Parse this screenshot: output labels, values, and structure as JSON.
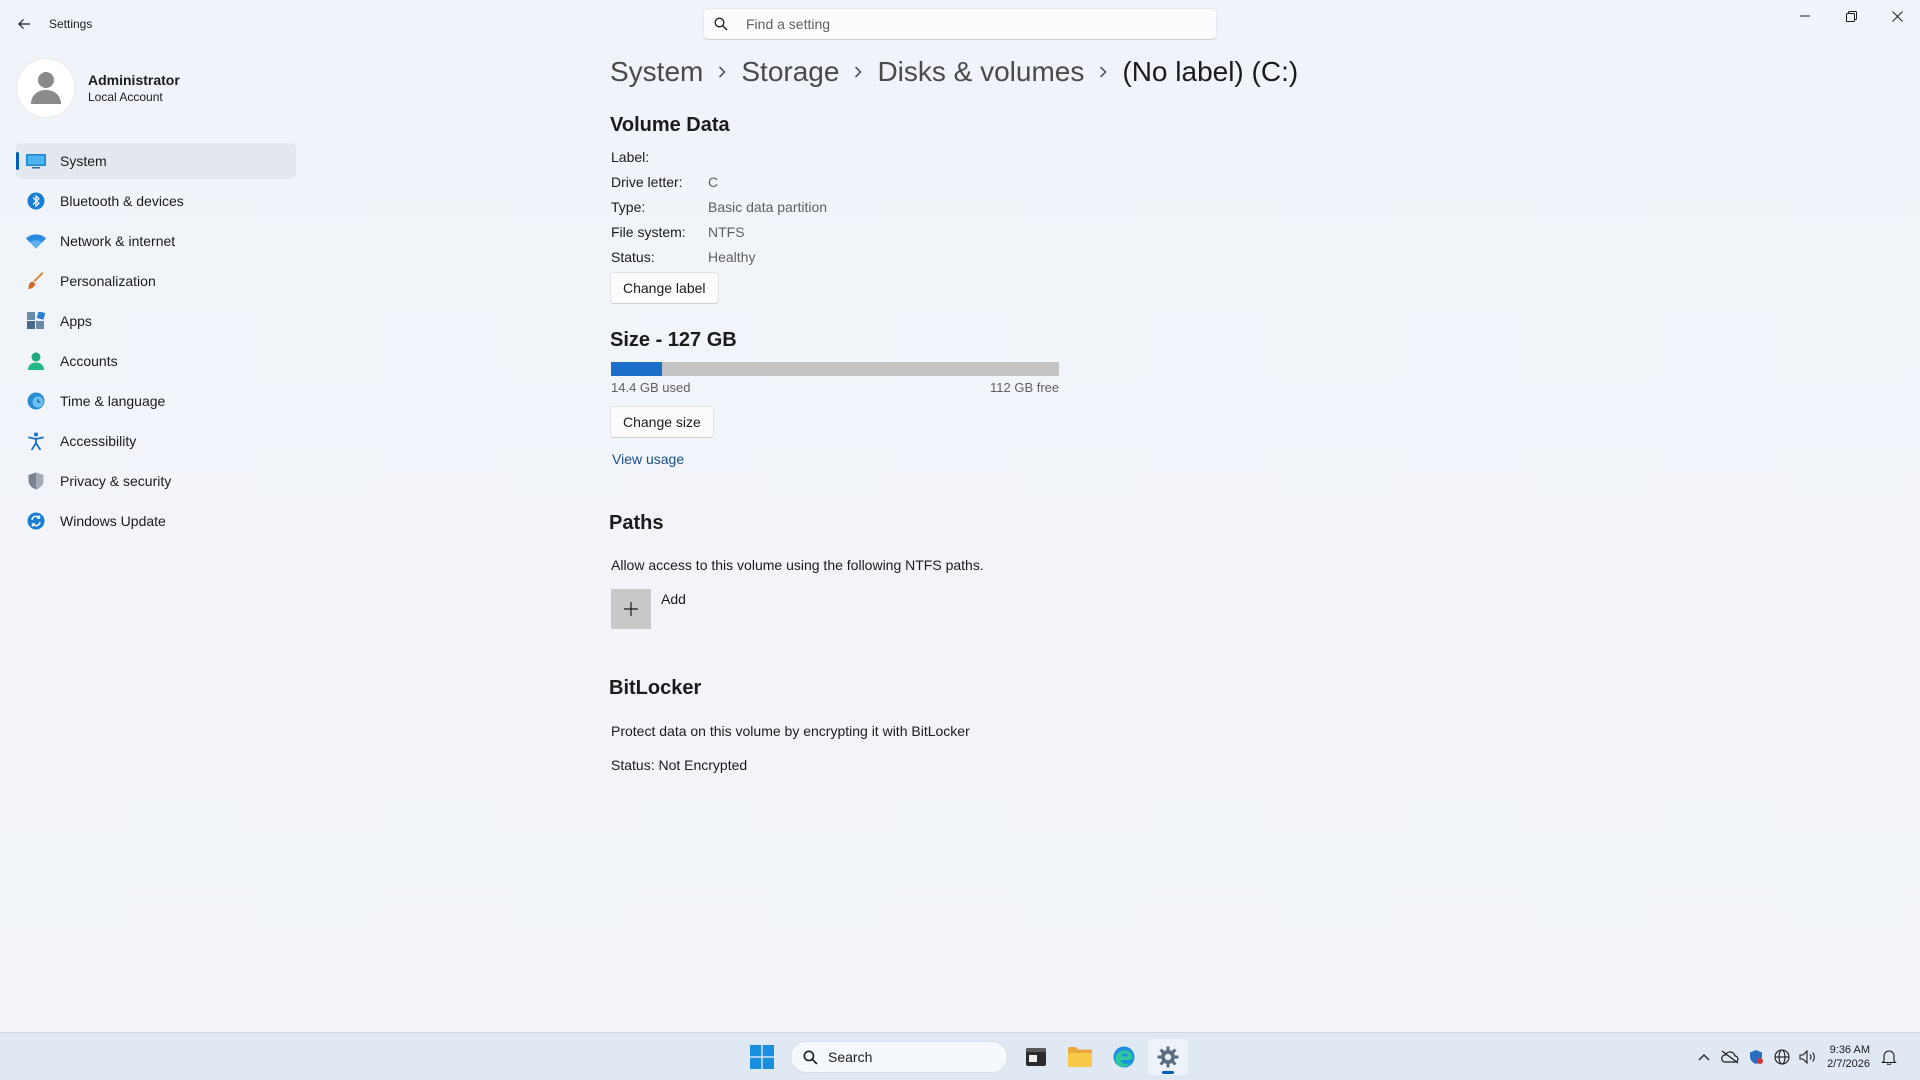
{
  "window": {
    "app_title": "Settings",
    "search_placeholder": "Find a setting"
  },
  "profile": {
    "name": "Administrator",
    "account_type": "Local Account"
  },
  "sidebar": {
    "items": [
      {
        "label": "System",
        "icon": "system-icon",
        "selected": true
      },
      {
        "label": "Bluetooth & devices",
        "icon": "bluetooth-icon"
      },
      {
        "label": "Network & internet",
        "icon": "wifi-icon"
      },
      {
        "label": "Personalization",
        "icon": "brush-icon"
      },
      {
        "label": "Apps",
        "icon": "apps-icon"
      },
      {
        "label": "Accounts",
        "icon": "person-icon"
      },
      {
        "label": "Time & language",
        "icon": "globe-clock-icon"
      },
      {
        "label": "Accessibility",
        "icon": "accessibility-icon"
      },
      {
        "label": "Privacy & security",
        "icon": "shield-icon"
      },
      {
        "label": "Windows Update",
        "icon": "update-icon"
      }
    ]
  },
  "breadcrumb": [
    "System",
    "Storage",
    "Disks & volumes",
    "(No label) (C:)"
  ],
  "volume_data": {
    "title": "Volume Data",
    "fields": [
      {
        "key": "Label:",
        "value": ""
      },
      {
        "key": "Drive letter:",
        "value": "C"
      },
      {
        "key": "Type:",
        "value": "Basic data partition"
      },
      {
        "key": "File system:",
        "value": "NTFS"
      },
      {
        "key": "Status:",
        "value": "Healthy"
      }
    ],
    "change_label_button": "Change label"
  },
  "size": {
    "title": "Size - 127 GB",
    "used_text": "14.4 GB used",
    "free_text": "112 GB free",
    "used_fraction": 0.113,
    "change_size_button": "Change size",
    "view_usage_link": "View usage"
  },
  "paths": {
    "title": "Paths",
    "description": "Allow access to this volume using the following NTFS paths.",
    "add_label": "Add"
  },
  "bitlocker": {
    "title": "BitLocker",
    "description": "Protect data on this volume by encrypting it with BitLocker",
    "status": "Status: Not Encrypted"
  },
  "taskbar": {
    "search_label": "Search",
    "time": "9:36 AM",
    "date": "2/7/2026"
  },
  "colors": {
    "accent": "#005fb8",
    "bar_used": "#1d70c9",
    "bar_free": "#c4c4c4"
  }
}
